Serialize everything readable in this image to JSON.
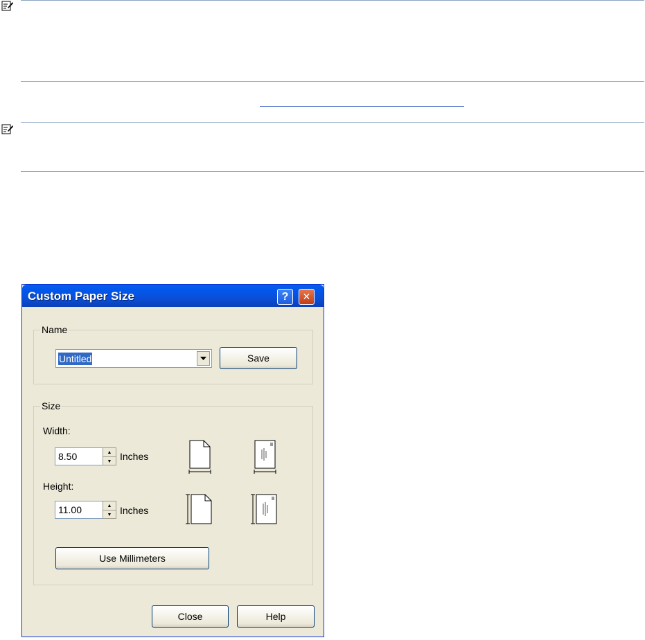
{
  "document": {
    "note_icons": [
      "note-icon",
      "note-icon"
    ]
  },
  "dialog": {
    "title": "Custom Paper Size",
    "title_buttons": {
      "help": "?",
      "close": "✕"
    },
    "name_group": {
      "label": "Name",
      "combo_value": "Untitled",
      "save_label": "Save"
    },
    "size_group": {
      "label": "Size",
      "width_label": "Width:",
      "width_value": "8.50",
      "width_unit": "Inches",
      "height_label": "Height:",
      "height_value": "11.00",
      "height_unit": "Inches",
      "use_mm_label": "Use Millimeters"
    },
    "footer": {
      "close_label": "Close",
      "help_label": "Help"
    },
    "colors": {
      "titlebar": "#0a4fd8",
      "face": "#ece9d8",
      "selection": "#316ac5",
      "close_button": "#c33d15"
    }
  }
}
